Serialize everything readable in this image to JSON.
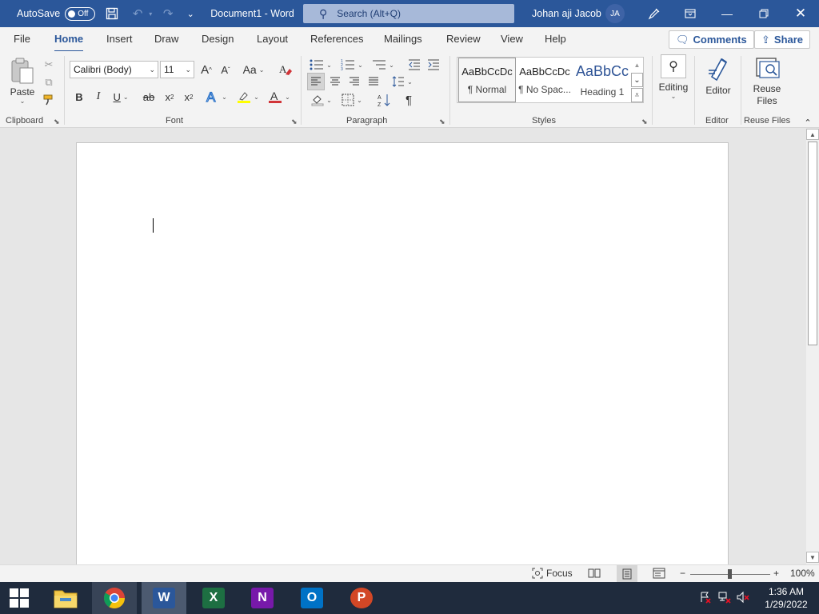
{
  "titlebar": {
    "autosave_label": "AutoSave",
    "autosave_state": "Off",
    "doc_title": "Document1  -  Word",
    "search_placeholder": "Search (Alt+Q)",
    "user_name": "Johan aji  Jacob",
    "user_initials": "JA"
  },
  "tabs": [
    "File",
    "Home",
    "Insert",
    "Draw",
    "Design",
    "Layout",
    "References",
    "Mailings",
    "Review",
    "View",
    "Help"
  ],
  "active_tab": "Home",
  "actions": {
    "comments": "Comments",
    "share": "Share"
  },
  "ribbon": {
    "clipboard": {
      "paste": "Paste",
      "label": "Clipboard"
    },
    "font": {
      "family": "Calibri (Body)",
      "size": "11",
      "label": "Font",
      "grow": "A",
      "shrink": "A",
      "case": "Aa",
      "bold": "B",
      "italic": "I",
      "underline": "U",
      "strike": "ab",
      "subscript": "x",
      "superscript": "x"
    },
    "paragraph": {
      "label": "Paragraph",
      "pilcrow": "¶"
    },
    "styles": {
      "label": "Styles",
      "items": [
        {
          "sample": "AaBbCcDc",
          "name": "¶ Normal"
        },
        {
          "sample": "AaBbCcDc",
          "name": "¶ No Spac..."
        },
        {
          "sample": "AaBbCc",
          "name": "Heading 1"
        }
      ]
    },
    "editing": {
      "label": "Editing"
    },
    "editor": {
      "button": "Editor",
      "label": "Editor"
    },
    "reuse": {
      "button_line1": "Reuse",
      "button_line2": "Files",
      "label": "Reuse Files"
    }
  },
  "status": {
    "focus": "Focus",
    "zoom": "100%",
    "zoom_minus": "−",
    "zoom_plus": "+"
  },
  "taskbar": {
    "time": "1:36 AM",
    "date": "1/29/2022",
    "apps": [
      {
        "name": "File Explorer",
        "letter": ""
      },
      {
        "name": "Chrome",
        "letter": ""
      },
      {
        "name": "Word",
        "letter": "W"
      },
      {
        "name": "Excel",
        "letter": "X"
      },
      {
        "name": "OneNote",
        "letter": "N"
      },
      {
        "name": "Outlook",
        "letter": "O"
      },
      {
        "name": "PowerPoint",
        "letter": "P"
      }
    ]
  },
  "colors": {
    "word_blue": "#2b579a",
    "highlight": "#ffff00",
    "font_red": "#d13438"
  }
}
